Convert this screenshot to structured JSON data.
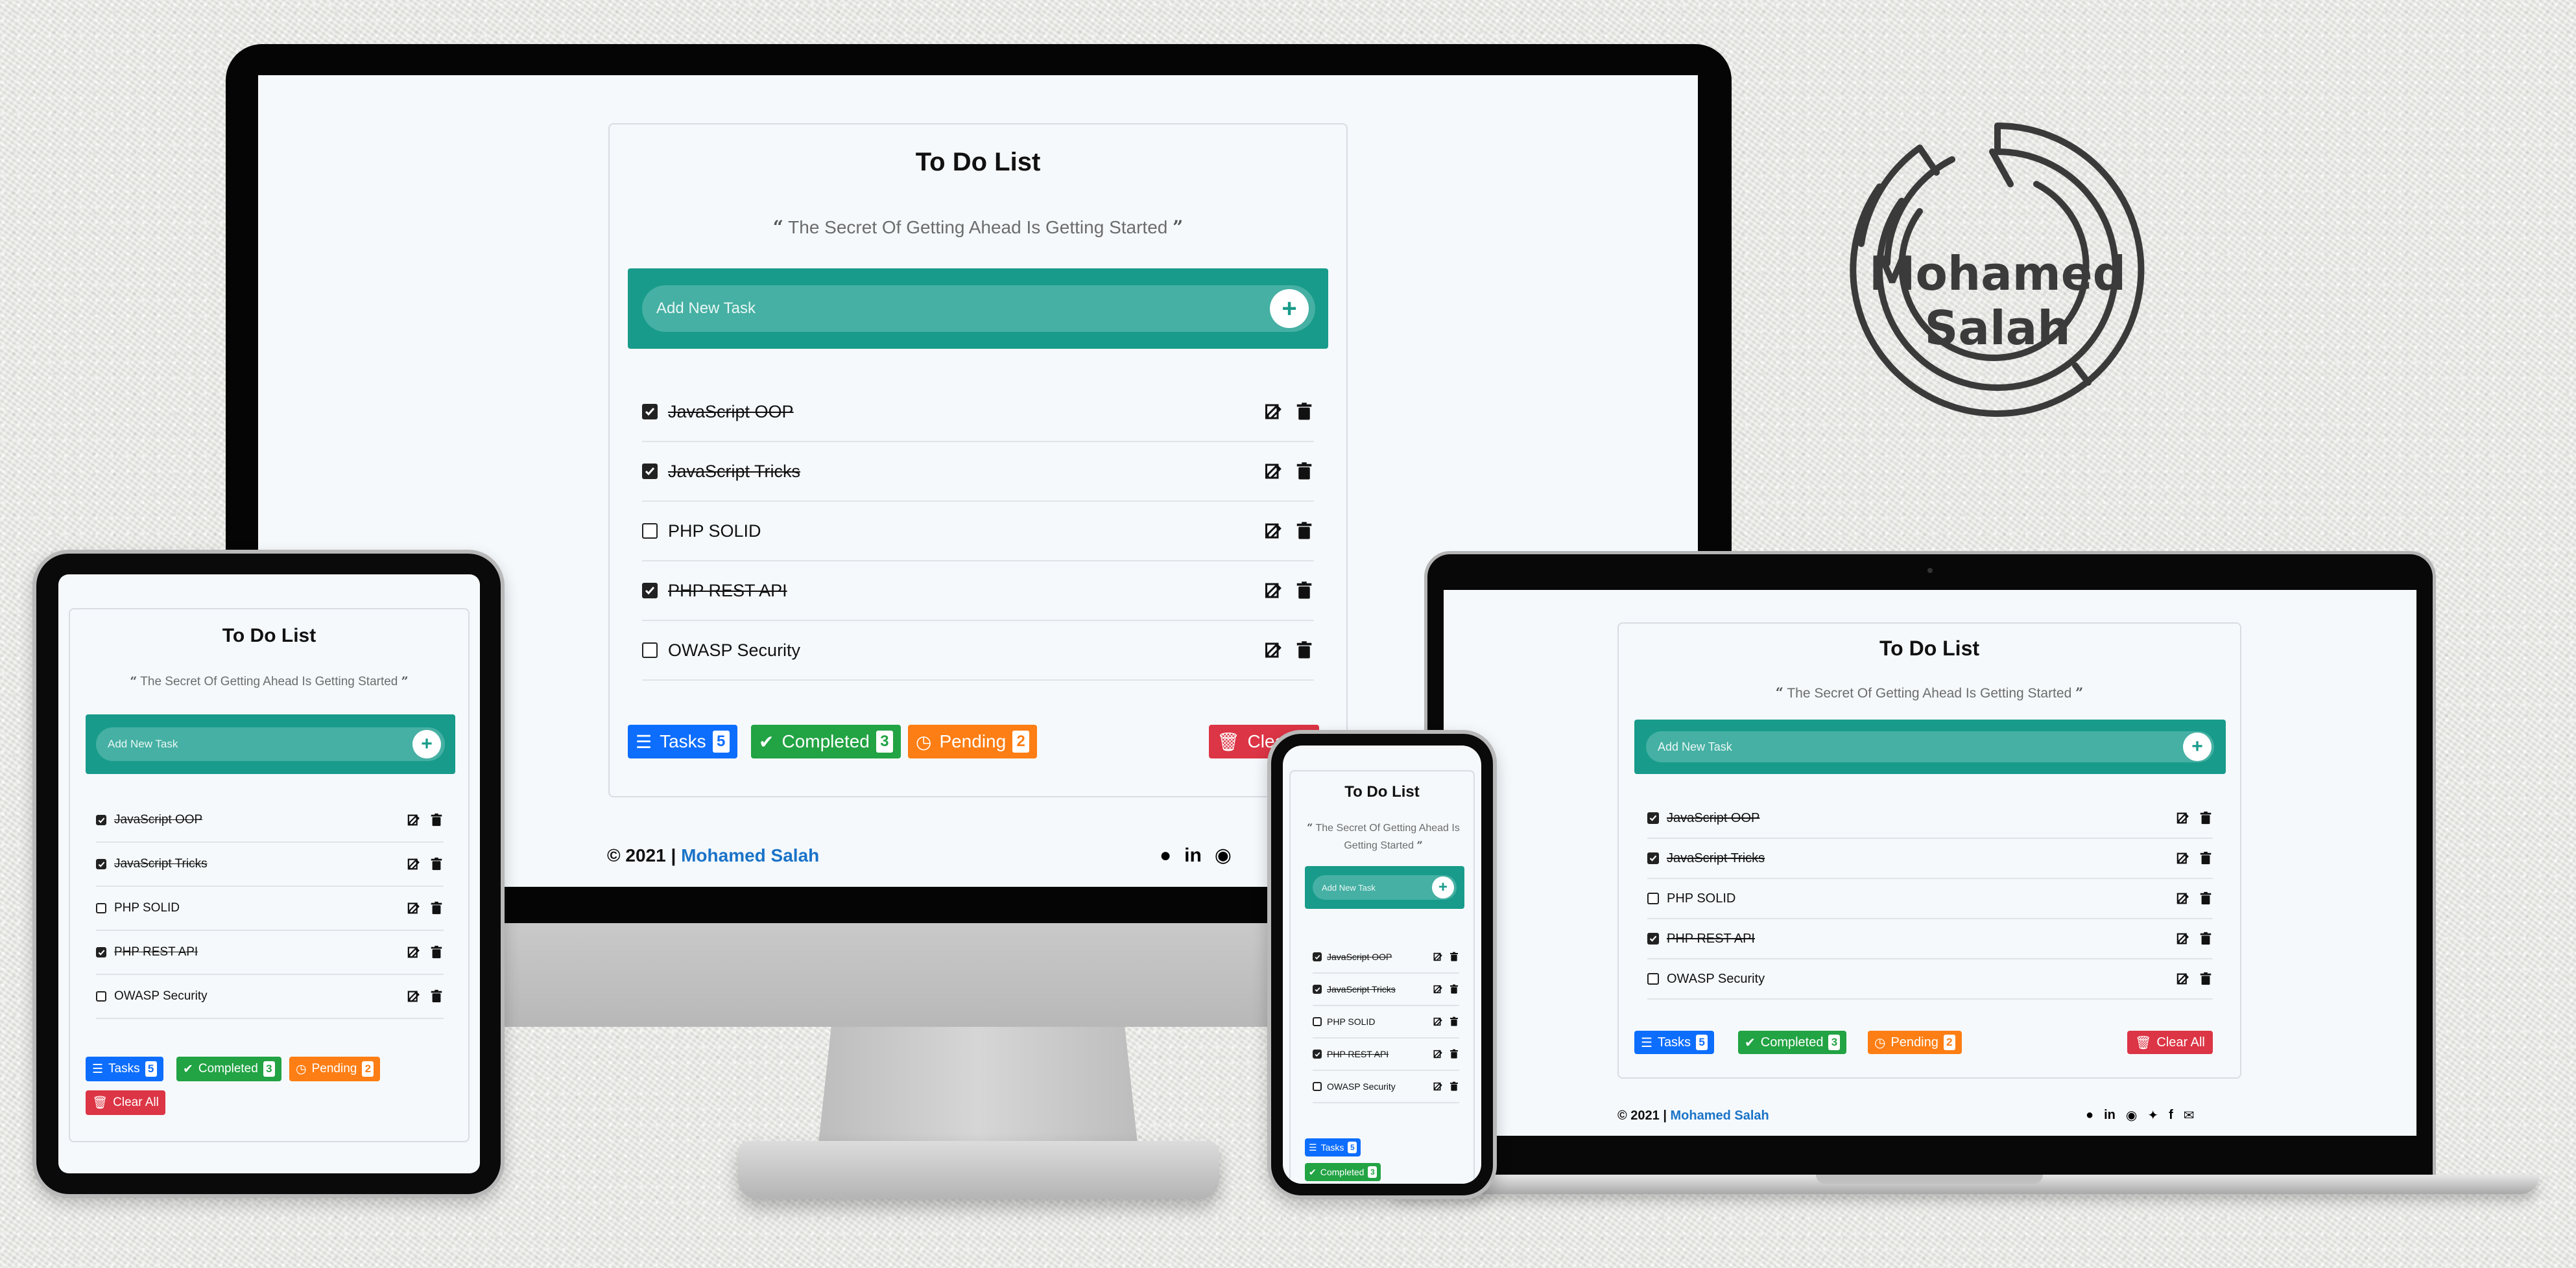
{
  "app": {
    "title": "To Do List",
    "quote": "The Secret Of Getting Ahead Is Getting Started",
    "quote_open": "“",
    "quote_close": "”",
    "add_placeholder": "Add New Task",
    "tasks": [
      {
        "label": "JavaScript OOP",
        "done": true
      },
      {
        "label": "JavaScript Tricks",
        "done": true
      },
      {
        "label": "PHP SOLID",
        "done": false
      },
      {
        "label": "PHP REST API",
        "done": true
      },
      {
        "label": "OWASP Security",
        "done": false
      }
    ],
    "stats": {
      "tasks_label": "Tasks",
      "tasks_count": "5",
      "completed_label": "Completed",
      "completed_count": "3",
      "pending_label": "Pending",
      "pending_count": "2"
    },
    "clear_label": "Clear All",
    "clear_label_cropped": "Clea",
    "footer_prefix": "© 2021 |",
    "footer_name": "Mohamed Salah",
    "social_icons": [
      "github-icon",
      "linkedin-icon",
      "globe-icon",
      "twitter-icon",
      "facebook-icon",
      "mail-icon"
    ]
  },
  "logo": {
    "line1": "Mohamed",
    "line2": "Salah"
  },
  "colors": {
    "teal": "#189b8a",
    "teal_input": "#45b0a3",
    "blue": "#0d6efd",
    "green": "#22a344",
    "orange": "#fd7e14",
    "red": "#dc3545",
    "link": "#1a73c8"
  }
}
